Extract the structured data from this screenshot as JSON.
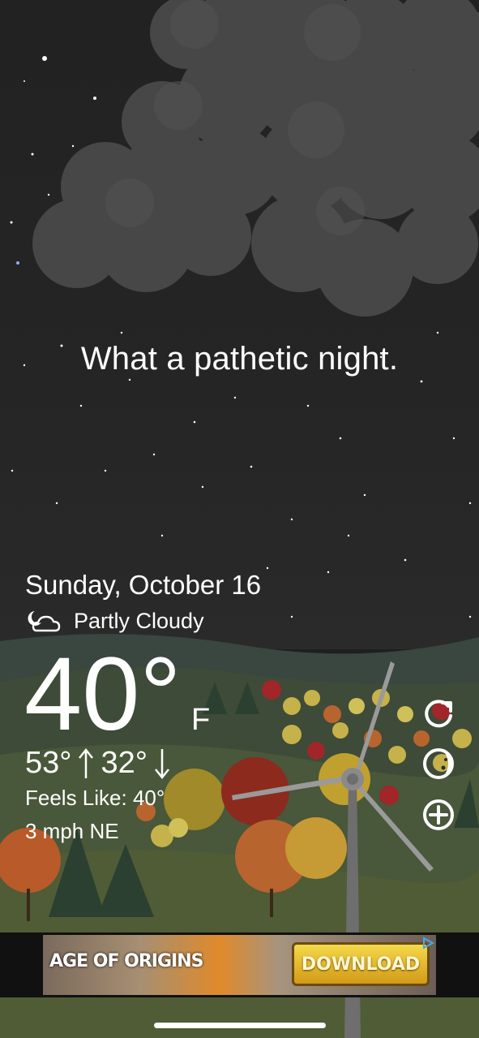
{
  "tagline": "What a pathetic night.",
  "date": "Sunday, October 16",
  "condition": {
    "icon": "partly-cloudy-night-icon",
    "text": "Partly Cloudy"
  },
  "temperature": {
    "value": "40°",
    "unit": "F"
  },
  "high": "53°",
  "low": "32°",
  "feels_like": "Feels Like: 40°",
  "wind": "3 mph NE",
  "actions": [
    {
      "icon": "refresh-icon"
    },
    {
      "icon": "moon-icon"
    },
    {
      "icon": "add-icon"
    }
  ],
  "ad": {
    "title": "AGE OF ORIGINS",
    "button": "DOWNLOAD"
  },
  "colors": {
    "sky": "#222222",
    "cloud": "#4a4a4a",
    "hill": "#3c4a3a",
    "text": "#ffffff"
  }
}
